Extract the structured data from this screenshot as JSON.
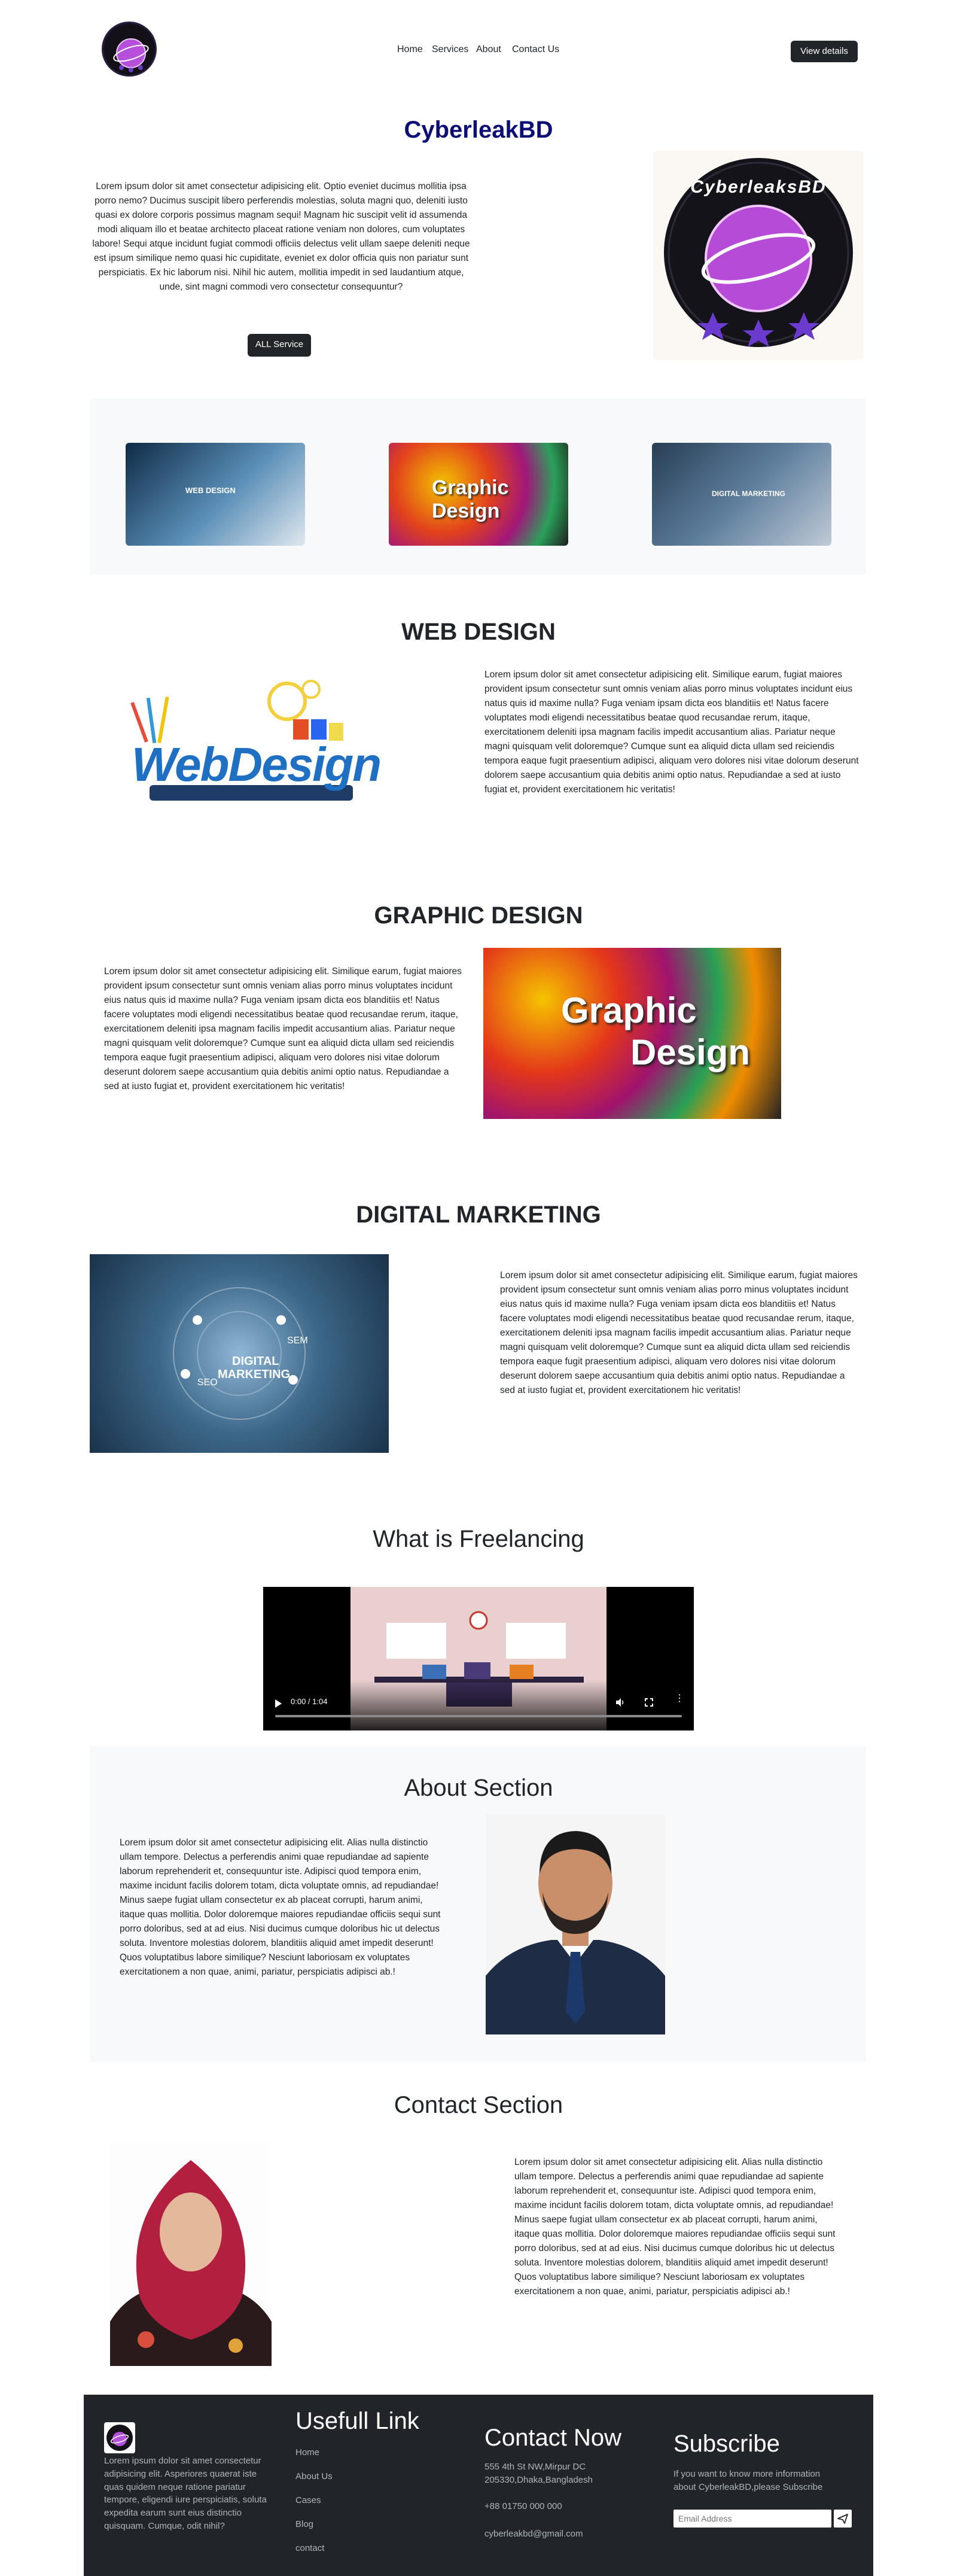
{
  "nav": {
    "logo_text": "CyberleaksBD",
    "links": [
      "Home",
      "Services",
      "About",
      "Contact Us"
    ],
    "cta": "View details"
  },
  "hero": {
    "title": "CyberleakBD",
    "paragraph": "Lorem ipsum dolor sit amet consectetur adipisicing elit. Optio eveniet ducimus mollitia ipsa porro nemo? Ducimus suscipit libero perferendis molestias, soluta magni quo, deleniti iusto quasi ex dolore corporis possimus magnam sequi! Magnam hic suscipit velit id assumenda modi aliquam illo et beatae architecto placeat ratione veniam non dolores, cum voluptates labore! Sequi atque incidunt fugiat commodi officiis delectus velit ullam saepe deleniti neque est ipsum similique nemo quasi hic cupiditate, eveniet ex dolor officia quis non pariatur sunt perspiciatis. Ex hic laborum nisi. Nihil hic autem, mollitia impedit in sed laudantium atque, unde, sint magni commodi vero consectetur consequuntur?",
    "button": "ALL Service",
    "logo_text": "CyberleaksBD"
  },
  "service_thumbs": [
    {
      "caption": "WEB DESIGN"
    },
    {
      "caption": "Graphic Design"
    },
    {
      "caption": "DIGITAL MARKETING"
    }
  ],
  "web_design": {
    "title": "WEB DESIGN",
    "image_text": "WebDesign",
    "paragraph": "Lorem ipsum dolor sit amet consectetur adipisicing elit. Similique earum, fugiat maiores provident ipsum consectetur sunt omnis veniam alias porro minus voluptates incidunt eius natus quis id maxime nulla? Fuga veniam ipsam dicta eos blanditiis et! Natus facere voluptates modi eligendi necessitatibus beatae quod recusandae rerum, itaque, exercitationem deleniti ipsa magnam facilis impedit accusantium alias. Pariatur neque magni quisquam velit doloremque? Cumque sunt ea aliquid dicta ullam sed reiciendis tempora eaque fugit praesentium adipisci, aliquam vero dolores nisi vitae dolorum deserunt dolorem saepe accusantium quia debitis animi optio natus. Repudiandae a sed at iusto fugiat et, provident exercitationem hic veritatis!"
  },
  "graphic_design": {
    "title": "GRAPHIC DESIGN",
    "image_text_1": "Graphic",
    "image_text_2": "Design",
    "paragraph": "Lorem ipsum dolor sit amet consectetur adipisicing elit. Similique earum, fugiat maiores provident ipsum consectetur sunt omnis veniam alias porro minus voluptates incidunt eius natus quis id maxime nulla? Fuga veniam ipsam dicta eos blanditiis et! Natus facere voluptates modi eligendi necessitatibus beatae quod recusandae rerum, itaque, exercitationem deleniti ipsa magnam facilis impedit accusantium alias. Pariatur neque magni quisquam velit doloremque? Cumque sunt ea aliquid dicta ullam sed reiciendis tempora eaque fugit praesentium adipisci, aliquam vero dolores nisi vitae dolorum deserunt dolorem saepe accusantium quia debitis animi optio natus. Repudiandae a sed at iusto fugiat et, provident exercitationem hic veritatis!"
  },
  "digital_marketing": {
    "title": "DIGITAL MARKETING",
    "image_text_1": "DIGITAL",
    "image_text_2": "MARKETING",
    "image_tags": [
      "SEM",
      "SEO"
    ],
    "paragraph": "Lorem ipsum dolor sit amet consectetur adipisicing elit. Similique earum, fugiat maiores provident ipsum consectetur sunt omnis veniam alias porro minus voluptates incidunt eius natus quis id maxime nulla? Fuga veniam ipsam dicta eos blanditiis et! Natus facere voluptates modi eligendi necessitatibus beatae quod recusandae rerum, itaque, exercitationem deleniti ipsa magnam facilis impedit accusantium alias. Pariatur neque magni quisquam velit doloremque? Cumque sunt ea aliquid dicta ullam sed reiciendis tempora eaque fugit praesentium adipisci, aliquam vero dolores nisi vitae dolorum deserunt dolorem saepe accusantium quia debitis animi optio natus. Repudiandae a sed at iusto fugiat et, provident exercitationem hic veritatis!"
  },
  "freelancing": {
    "title": "What is Freelancing",
    "video_time": "0:00 / 1:04"
  },
  "about": {
    "title": "About Section",
    "paragraph": "Lorem ipsum dolor sit amet consectetur adipisicing elit. Alias nulla distinctio ullam tempore. Delectus a perferendis animi quae repudiandae ad sapiente laborum reprehenderit et, consequuntur iste. Adipisci quod tempora enim, maxime incidunt facilis dolorem totam, dicta voluptate omnis, ad repudiandae! Minus saepe fugiat ullam consectetur ex ab placeat corrupti, harum animi, itaque quas mollitia. Dolor doloremque maiores repudiandae officiis sequi sunt porro doloribus, sed at ad eius. Nisi ducimus cumque doloribus hic ut delectus soluta. Inventore molestias dolorem, blanditiis aliquid amet impedit deserunt! Quos voluptatibus labore similique? Nesciunt laboriosam ex voluptates exercitationem a non quae, animi, pariatur, perspiciatis adipisci ab.!"
  },
  "contact": {
    "title": "Contact Section",
    "paragraph": "Lorem ipsum dolor sit amet consectetur adipisicing elit. Alias nulla distinctio ullam tempore. Delectus a perferendis animi quae repudiandae ad sapiente laborum reprehenderit et, consequuntur iste. Adipisci quod tempora enim, maxime incidunt facilis dolorem totam, dicta voluptate omnis, ad repudiandae! Minus saepe fugiat ullam consectetur ex ab placeat corrupti, harum animi, itaque quas mollitia. Dolor doloremque maiores repudiandae officiis sequi sunt porro doloribus, sed at ad eius. Nisi ducimus cumque doloribus hic ut delectus soluta. Inventore molestias dolorem, blanditiis aliquid amet impedit deserunt! Quos voluptatibus labore similique? Nesciunt laboriosam ex voluptates exercitationem a non quae, animi, pariatur, perspiciatis adipisci ab.!"
  },
  "footer": {
    "about_text": "Lorem ipsum dolor sit amet consectetur adipisicing elit. Asperiores quaerat iste quas quidem neque ratione pariatur tempore, eligendi iure perspiciatis, soluta expedita earum sunt eius distinctio quisquam. Cumque, odit nihil?",
    "links_title": "Usefull Link",
    "links": [
      "Home",
      "About Us",
      "Cases",
      "Blog",
      "contact"
    ],
    "contact_title": "Contact Now",
    "address_1": "555 4th St NW,Mirpur DC",
    "address_2": "205330,Dhaka,Bangladesh",
    "phone": "+88 01750 000 000",
    "email": "cyberleakbd@gmail.com",
    "subscribe_title": "Subscribe",
    "subscribe_text": "If you want to know more information about CyberleakBD,please Subscribe",
    "email_placeholder": "Email Address"
  },
  "colors": {
    "brand_title": "#0d0d77",
    "dark": "#212529",
    "section_bg": "#f8f9fa"
  }
}
